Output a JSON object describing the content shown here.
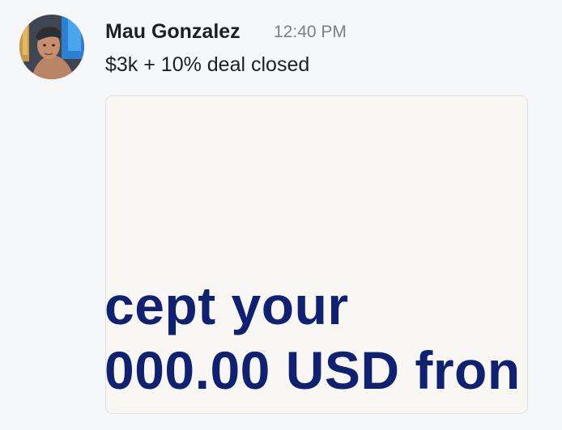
{
  "message": {
    "author": "Mau Gonzalez",
    "time": "12:40 PM",
    "text": "$3k + 10% deal closed"
  },
  "attachment": {
    "line1": "cept your",
    "line2": "000.00 USD fron"
  },
  "colors": {
    "background": "#f6f7f9",
    "author": "#1d1f23",
    "timestamp": "#7b7f86",
    "attachment_text": "#0f2170",
    "attachment_bg": "#f9f7f4"
  }
}
